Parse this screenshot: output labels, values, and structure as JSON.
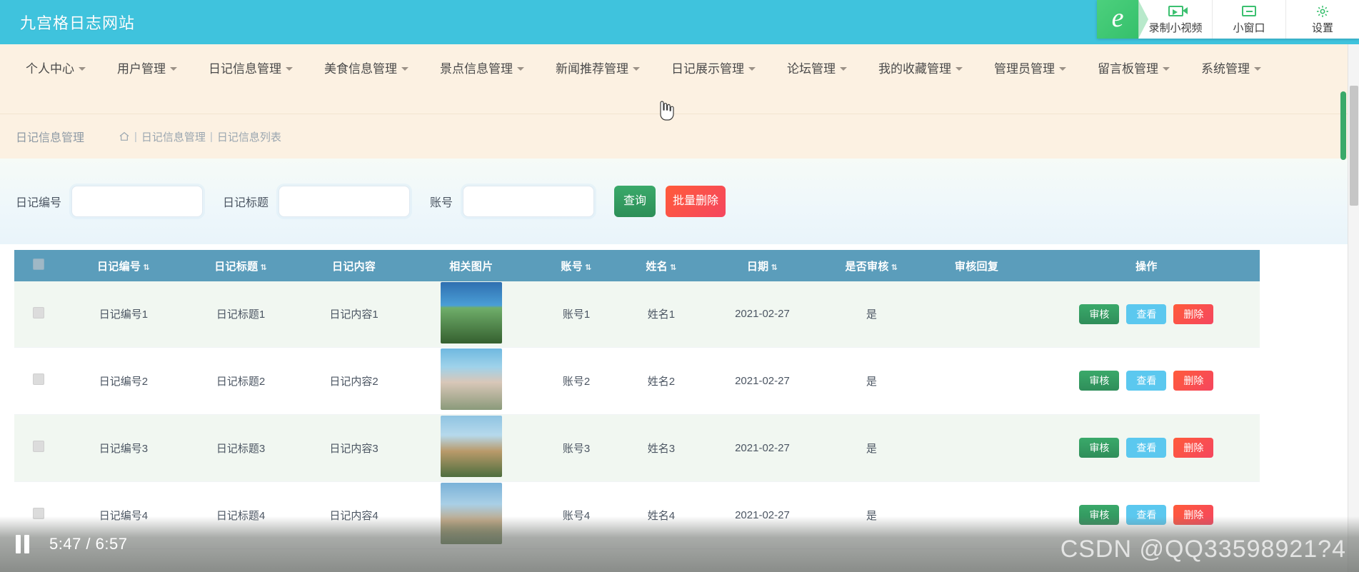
{
  "header": {
    "site_title": "九宫格日志网站",
    "bg_color": "#3fc3dd"
  },
  "recorder_overlay": {
    "logo_glyph": "e",
    "items": [
      {
        "label": "录制小视频",
        "icon": "video-icon"
      },
      {
        "label": "小窗口",
        "icon": "minimize-window-icon"
      },
      {
        "label": "设置",
        "icon": "gear-icon"
      }
    ]
  },
  "nav": {
    "items": [
      {
        "label": "个人中心"
      },
      {
        "label": "用户管理"
      },
      {
        "label": "日记信息管理"
      },
      {
        "label": "美食信息管理"
      },
      {
        "label": "景点信息管理"
      },
      {
        "label": "新闻推荐管理"
      },
      {
        "label": "日记展示管理"
      },
      {
        "label": "论坛管理"
      },
      {
        "label": "我的收藏管理"
      },
      {
        "label": "管理员管理"
      },
      {
        "label": "留言板管理"
      },
      {
        "label": "系统管理"
      }
    ]
  },
  "breadcrumb": {
    "module_title": "日记信息管理",
    "home_icon": "home-icon",
    "sep": "|",
    "item1": "日记信息管理",
    "item2": "日记信息列表"
  },
  "search": {
    "fields": [
      {
        "label": "日记编号",
        "value": "",
        "placeholder": ""
      },
      {
        "label": "日记标题",
        "value": "",
        "placeholder": ""
      },
      {
        "label": "账号",
        "value": "",
        "placeholder": ""
      }
    ],
    "search_button": "查询",
    "batch_delete_button": "批量删除",
    "search_color": "#2d8f58",
    "delete_color": "#f5465f"
  },
  "table": {
    "columns": [
      {
        "label": "",
        "sortable": false
      },
      {
        "label": "日记编号",
        "sortable": true
      },
      {
        "label": "日记标题",
        "sortable": true
      },
      {
        "label": "日记内容",
        "sortable": false
      },
      {
        "label": "相关图片",
        "sortable": false
      },
      {
        "label": "账号",
        "sortable": true
      },
      {
        "label": "姓名",
        "sortable": true
      },
      {
        "label": "日期",
        "sortable": true
      },
      {
        "label": "是否审核",
        "sortable": true
      },
      {
        "label": "审核回复",
        "sortable": false
      },
      {
        "label": "操作",
        "sortable": false
      }
    ],
    "sort_glyph": "⇅",
    "header_bg": "#5b9dbb",
    "rows": [
      {
        "id": "日记编号1",
        "title": "日记标题1",
        "content": "日记内容1",
        "image": "diary-thumbnail-1",
        "account": "账号1",
        "name": "姓名1",
        "date": "2021-02-27",
        "audited": "是",
        "reply": ""
      },
      {
        "id": "日记编号2",
        "title": "日记标题2",
        "content": "日记内容2",
        "image": "diary-thumbnail-2",
        "account": "账号2",
        "name": "姓名2",
        "date": "2021-02-27",
        "audited": "是",
        "reply": ""
      },
      {
        "id": "日记编号3",
        "title": "日记标题3",
        "content": "日记内容3",
        "image": "diary-thumbnail-3",
        "account": "账号3",
        "name": "姓名3",
        "date": "2021-02-27",
        "audited": "是",
        "reply": ""
      },
      {
        "id": "日记编号4",
        "title": "日记标题4",
        "content": "日记内容4",
        "image": "diary-thumbnail-4",
        "account": "账号4",
        "name": "姓名4",
        "date": "2021-02-27",
        "audited": "是",
        "reply": ""
      }
    ],
    "actions": {
      "audit": "审核",
      "view": "查看",
      "delete": "删除"
    }
  },
  "player": {
    "state_icon": "pause-icon",
    "current_time": "5:47",
    "separator": "/",
    "total_time": "6:57",
    "time_display": "5:47 / 6:57"
  },
  "watermark": {
    "text": "CSDN @QQ33598921?4"
  }
}
